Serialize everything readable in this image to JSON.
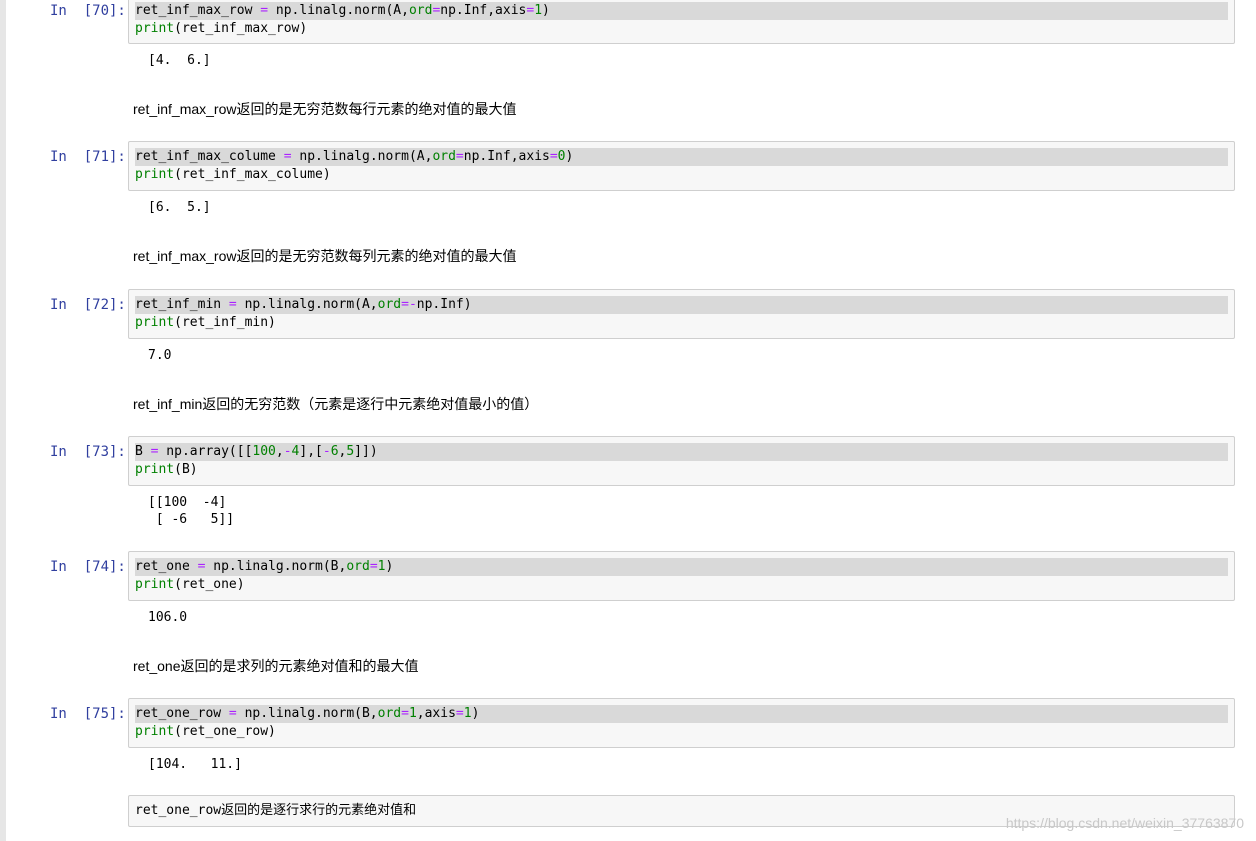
{
  "cells": [
    {
      "prompt": "In  [70]:",
      "code": [
        {
          "tokens": [
            [
              "",
              "ret_inf_max_row "
            ],
            [
              "op",
              "="
            ],
            [
              "",
              " np.linalg.norm(A,"
            ],
            [
              "arg",
              "ord"
            ],
            [
              "op",
              "="
            ],
            [
              "",
              "np.Inf,axis"
            ],
            [
              "op",
              "="
            ],
            [
              "num",
              "1"
            ],
            [
              "",
              ")"
            ]
          ]
        },
        {
          "tokens": [
            [
              "kw",
              "print"
            ],
            [
              "",
              "(ret_inf_max_row)"
            ]
          ]
        }
      ],
      "output": "[4.  6.]",
      "note": "ret_inf_max_row返回的是无穷范数每行元素的绝对值的最大值"
    },
    {
      "prompt": "In  [71]:",
      "code": [
        {
          "tokens": [
            [
              "",
              "ret_inf_max_colume "
            ],
            [
              "op",
              "="
            ],
            [
              "",
              " np.linalg.norm(A,"
            ],
            [
              "arg",
              "ord"
            ],
            [
              "op",
              "="
            ],
            [
              "",
              "np.Inf,axis"
            ],
            [
              "op",
              "="
            ],
            [
              "num",
              "0"
            ],
            [
              "",
              ")"
            ]
          ]
        },
        {
          "tokens": [
            [
              "kw",
              "print"
            ],
            [
              "",
              "(ret_inf_max_colume)"
            ]
          ]
        }
      ],
      "output": "[6.  5.]",
      "note": "ret_inf_max_row返回的是无穷范数每列元素的绝对值的最大值"
    },
    {
      "prompt": "In  [72]:",
      "code": [
        {
          "tokens": [
            [
              "",
              "ret_inf_min "
            ],
            [
              "op",
              "="
            ],
            [
              "",
              " np.linalg.norm(A,"
            ],
            [
              "arg",
              "ord"
            ],
            [
              "op",
              "=-"
            ],
            [
              "",
              "np.Inf)"
            ]
          ]
        },
        {
          "tokens": [
            [
              "kw",
              "print"
            ],
            [
              "",
              "(ret_inf_min)"
            ]
          ]
        }
      ],
      "output": "7.0",
      "note": "ret_inf_min返回的无穷范数（元素是逐行中元素绝对值最小的值）"
    },
    {
      "prompt": "In  [73]:",
      "code": [
        {
          "tokens": [
            [
              "",
              "B "
            ],
            [
              "op",
              "="
            ],
            [
              "",
              " np.array([["
            ],
            [
              "num",
              "100"
            ],
            [
              "",
              ","
            ],
            [
              "op",
              "-"
            ],
            [
              "num",
              "4"
            ],
            [
              "",
              "],["
            ],
            [
              "op",
              "-"
            ],
            [
              "num",
              "6"
            ],
            [
              "",
              ","
            ],
            [
              "num",
              "5"
            ],
            [
              "",
              "]])"
            ]
          ]
        },
        {
          "tokens": [
            [
              "kw",
              "print"
            ],
            [
              "",
              "(B)"
            ]
          ]
        }
      ],
      "output": "[[100  -4]\n [ -6   5]]",
      "note": ""
    },
    {
      "prompt": "In  [74]:",
      "code": [
        {
          "tokens": [
            [
              "",
              "ret_one "
            ],
            [
              "op",
              "="
            ],
            [
              "",
              " np.linalg.norm(B,"
            ],
            [
              "arg",
              "ord"
            ],
            [
              "op",
              "="
            ],
            [
              "num",
              "1"
            ],
            [
              "",
              ")"
            ]
          ]
        },
        {
          "tokens": [
            [
              "kw",
              "print"
            ],
            [
              "",
              "(ret_one)"
            ]
          ]
        }
      ],
      "output": "106.0",
      "note": "ret_one返回的是求列的元素绝对值和的最大值"
    },
    {
      "prompt": "In  [75]:",
      "code": [
        {
          "tokens": [
            [
              "",
              "ret_one_row "
            ],
            [
              "op",
              "="
            ],
            [
              "",
              " np.linalg.norm(B,"
            ],
            [
              "arg",
              "ord"
            ],
            [
              "op",
              "="
            ],
            [
              "num",
              "1"
            ],
            [
              "",
              ",axis"
            ],
            [
              "op",
              "="
            ],
            [
              "num",
              "1"
            ],
            [
              "",
              ")"
            ]
          ]
        },
        {
          "tokens": [
            [
              "kw",
              "print"
            ],
            [
              "",
              "(ret_one_row)"
            ]
          ]
        }
      ],
      "output": "[104.   11.]",
      "note": ""
    }
  ],
  "editing_markdown": "ret_one_row返回的是逐行求行的元素绝对值和",
  "watermark": "https://blog.csdn.net/weixin_37763870",
  "colors": {
    "prompt": "#303f9f",
    "keyword": "#008000",
    "operator": "#aa22ff",
    "cell_bg": "#f7f7f7",
    "cell_border": "#cfcfcf",
    "selection": "#d9d9d9"
  }
}
